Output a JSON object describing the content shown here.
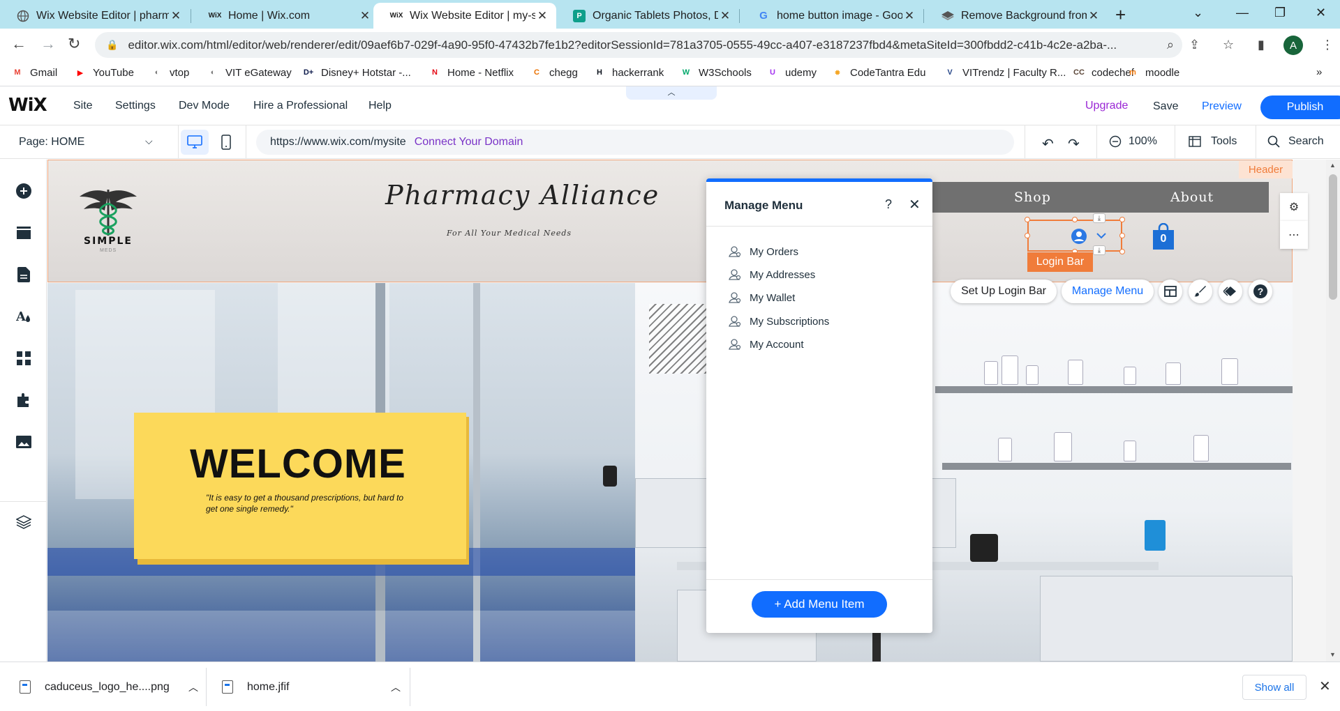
{
  "browser": {
    "tabs": [
      {
        "title": "Wix Website Editor | pharm",
        "favicon": "globe-icon"
      },
      {
        "title": "Home | Wix.com",
        "favicon": "wix-icon"
      },
      {
        "title": "Wix Website Editor | my-site",
        "favicon": "wix-icon"
      },
      {
        "title": "Organic Tablets Photos, Do",
        "favicon": "freepik-icon"
      },
      {
        "title": "home button image - Goog",
        "favicon": "google-icon"
      },
      {
        "title": "Remove Background from I",
        "favicon": "removebg-icon"
      }
    ],
    "url": "editor.wix.com/html/editor/web/renderer/edit/09aef6b7-029f-4a90-95f0-47432b7fe1b2?editorSessionId=781a3705-0555-49cc-a407-e3187237fbd4&metaSiteId=300fbdd2-c41b-4c2e-a2ba-...",
    "profile_initial": "A",
    "bookmarks": [
      {
        "label": "Gmail",
        "icon": "gmail-icon",
        "color": "#ea4335"
      },
      {
        "label": "YouTube",
        "icon": "youtube-icon",
        "color": "#ff0000"
      },
      {
        "label": "vtop",
        "icon": "vit-icon",
        "color": "#7a7a7a"
      },
      {
        "label": "VIT eGateway",
        "icon": "vit-icon",
        "color": "#7a7a7a"
      },
      {
        "label": "Disney+ Hotstar -...",
        "icon": "hotstar-icon",
        "color": "#0c1a4b"
      },
      {
        "label": "Home - Netflix",
        "icon": "netflix-icon",
        "color": "#e50914"
      },
      {
        "label": "chegg",
        "icon": "chegg-icon",
        "color": "#eb7100"
      },
      {
        "label": "hackerrank",
        "icon": "hackerrank-icon",
        "color": "#0e141e"
      },
      {
        "label": "W3Schools",
        "icon": "w3schools-icon",
        "color": "#04aa6d"
      },
      {
        "label": "udemy",
        "icon": "udemy-icon",
        "color": "#a435f0"
      },
      {
        "label": "CodeTantra Edu",
        "icon": "codetantra-icon",
        "color": "#f5a623"
      },
      {
        "label": "VITrendz | Faculty R...",
        "icon": "vitrendz-icon",
        "color": "#2b4a8b"
      },
      {
        "label": "codechef",
        "icon": "codechef-icon",
        "color": "#5b4638"
      },
      {
        "label": "moodle",
        "icon": "moodle-icon",
        "color": "#f98012"
      }
    ]
  },
  "wix": {
    "logo": "WiX",
    "menu": [
      "Site",
      "Settings",
      "Dev Mode",
      "Hire a Professional",
      "Help"
    ],
    "upgrade": "Upgrade",
    "save": "Save",
    "preview": "Preview",
    "publish": "Publish",
    "page_selector": "Page: HOME",
    "site_url": "https://www.wix.com/mysite",
    "connect_domain": "Connect Your Domain",
    "zoom": "100%",
    "tools": "Tools",
    "search": "Search"
  },
  "site": {
    "header_tag": "Header",
    "logo_text": "SIMPLE",
    "logo_sub": "MEDS",
    "title": "Pharmacy Alliance",
    "tagline": "For All Your Medical Needs",
    "nav": [
      "Shop",
      "About"
    ],
    "cart_count": "0",
    "login_bar_label": "Login Bar",
    "welcome_heading": "WELCOME",
    "welcome_quote": "\"It is easy to get a thousand prescriptions, but hard to get one single remedy.\""
  },
  "floating_toolbar": {
    "setup_login_bar": "Set Up Login Bar",
    "manage_menu": "Manage Menu"
  },
  "manage_menu": {
    "title": "Manage Menu",
    "items": [
      "My Orders",
      "My Addresses",
      "My Wallet",
      "My Subscriptions",
      "My Account"
    ],
    "add_button": "+ Add Menu Item"
  },
  "downloads": {
    "items": [
      "caduceus_logo_he....png",
      "home.jfif"
    ],
    "show_all": "Show all"
  },
  "colors": {
    "wix_blue": "#116dff",
    "selection_orange": "#f07c3a",
    "welcome_yellow": "#fcd95a",
    "upgrade_purple": "#9a27d5"
  }
}
